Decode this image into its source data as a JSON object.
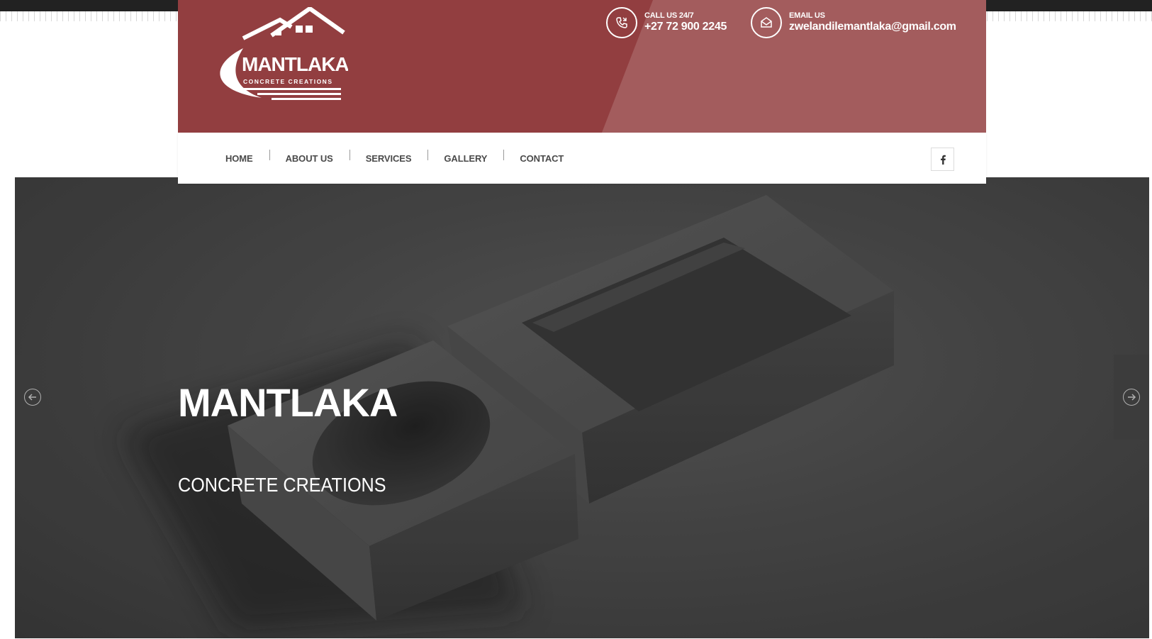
{
  "brand": {
    "logo_name": "MANTLAKA",
    "logo_tagline": "CONCRETE CREATIONS",
    "header_color": "#923e40"
  },
  "contact": {
    "call_label": "CALL US 24/7",
    "call_value": "+27 72 900 2245",
    "email_label": "EMAIL US",
    "email_value": "zwelandilemantlaka@gmail.com"
  },
  "nav": {
    "items": [
      {
        "label": "HOME"
      },
      {
        "label": "ABOUT US"
      },
      {
        "label": "SERVICES"
      },
      {
        "label": "GALLERY"
      },
      {
        "label": "CONTACT"
      }
    ],
    "social_icon": "facebook-icon"
  },
  "hero": {
    "title": "MANTLAKA",
    "subtitle": "CONCRETE CREATIONS",
    "prev_icon": "arrow-left-icon",
    "next_icon": "arrow-right-icon"
  }
}
